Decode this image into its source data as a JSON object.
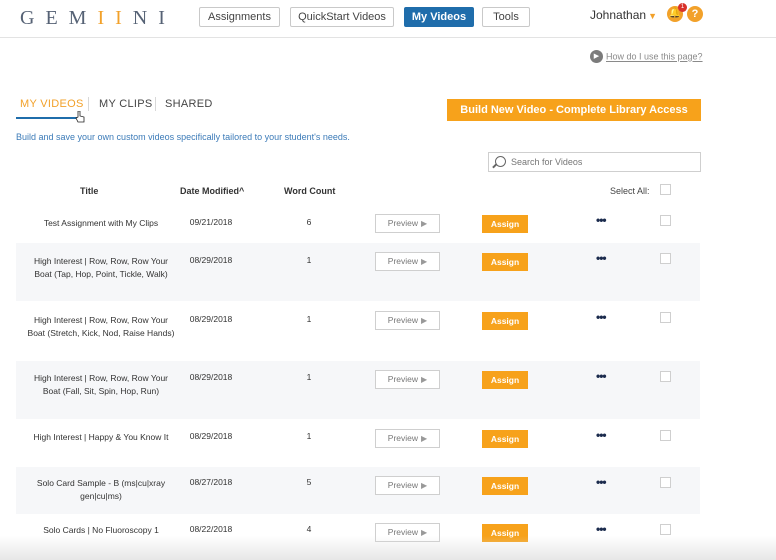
{
  "app": {
    "logo_left": "GEM",
    "logo_mid": "II",
    "logo_right": "NI"
  },
  "nav": {
    "assignments": "Assignments",
    "quickstart": "QuickStart Videos",
    "my_videos": "My Videos",
    "tools": "Tools"
  },
  "user": {
    "name": "Johnathan",
    "notification_count": "1"
  },
  "help_link": "How do I use this page?",
  "subtabs": {
    "my_videos": "MY VIDEOS",
    "my_clips": "MY CLIPS",
    "shared": "SHARED"
  },
  "build_button": "Build New Video - Complete Library Access",
  "description": "Build and save your own custom videos specifically tailored to your student's needs.",
  "search": {
    "placeholder": "Search for Videos"
  },
  "table": {
    "headers": {
      "title": "Title",
      "date": "Date Modified",
      "sort_icon": "^",
      "word_count": "Word Count",
      "select_all": "Select All:"
    },
    "preview_label": "Preview",
    "assign_label": "Assign",
    "rows": [
      {
        "title": "Test Assignment with My Clips",
        "date": "09/21/2018",
        "word_count": "6"
      },
      {
        "title": "High Interest | Row, Row, Row Your Boat (Tap, Hop, Point, Tickle, Walk)",
        "date": "08/29/2018",
        "word_count": "1"
      },
      {
        "title": "High Interest | Row, Row, Row Your Boat (Stretch, Kick, Nod, Raise Hands)",
        "date": "08/29/2018",
        "word_count": "1"
      },
      {
        "title": "High Interest | Row, Row, Row Your Boat (Fall, Sit, Spin, Hop, Run)",
        "date": "08/29/2018",
        "word_count": "1"
      },
      {
        "title": "High Interest | Happy & You Know It",
        "date": "08/29/2018",
        "word_count": "1"
      },
      {
        "title": "Solo Card Sample - B (ms|cu|xray gen|cu|ms)",
        "date": "08/27/2018",
        "word_count": "5"
      },
      {
        "title": "Solo Cards | No Fluoroscopy 1",
        "date": "08/22/2018",
        "word_count": "4"
      }
    ]
  },
  "colors": {
    "accent_orange": "#f7a21b",
    "primary_blue": "#1f6dab",
    "logo_gray": "#566275"
  }
}
